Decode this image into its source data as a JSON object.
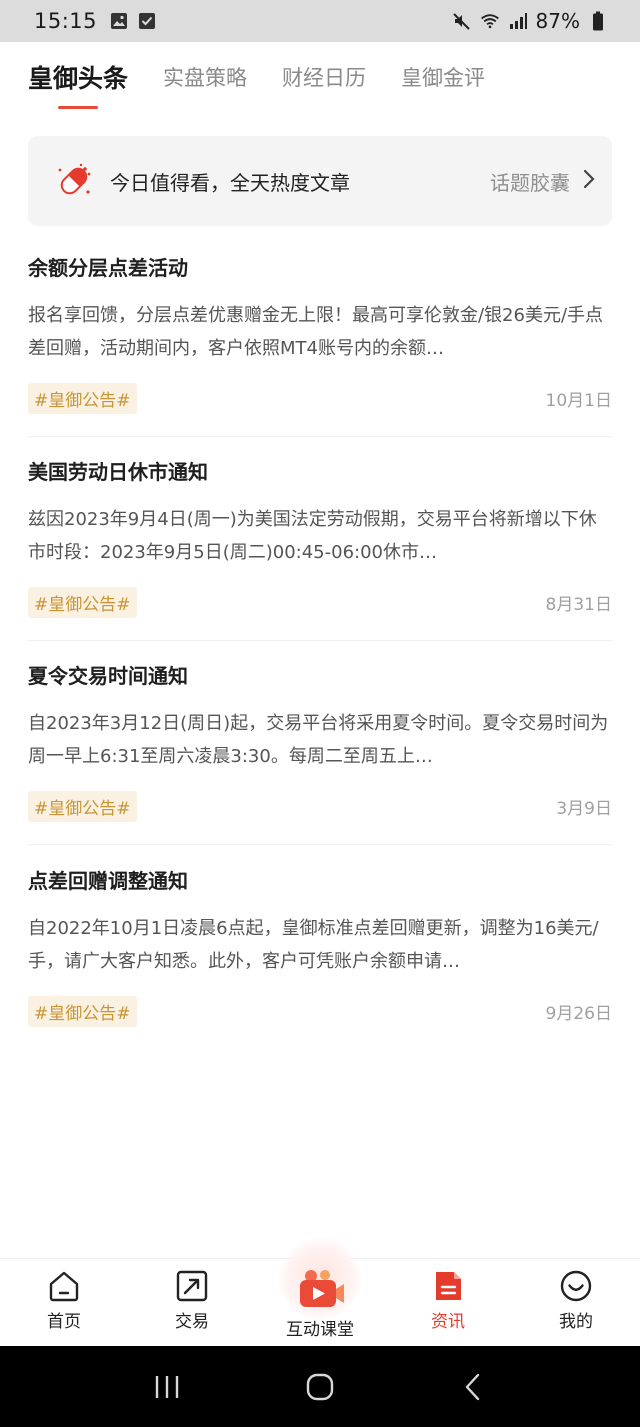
{
  "status_bar": {
    "time": "15:15",
    "battery": "87%",
    "icons": [
      "image-icon",
      "checkbox-icon",
      "mute-icon",
      "wifi-icon",
      "signal-icon",
      "battery-icon"
    ]
  },
  "tabs": [
    {
      "label": "皇御头条",
      "active": true
    },
    {
      "label": "实盘策略",
      "active": false
    },
    {
      "label": "财经日历",
      "active": false
    },
    {
      "label": "皇御金评",
      "active": false
    }
  ],
  "banner": {
    "text": "今日值得看，全天热度文章",
    "link": "话题胶囊"
  },
  "articles": [
    {
      "title": "余额分层点差活动",
      "desc": "报名享回馈，分层点差优惠赠金无上限！最高可享伦敦金/银26美元/手点差回赠，活动期间内，客户依照MT4账号内的余额…",
      "tag": "#皇御公告#",
      "date": "10月1日"
    },
    {
      "title": "美国劳动日休市通知",
      "desc": "兹因2023年9月4日(周一)为美国法定劳动假期，交易平台将新增以下休市时段：2023年9月5日(周二)00:45-06:00休市…",
      "tag": "#皇御公告#",
      "date": "8月31日"
    },
    {
      "title": "夏令交易时间通知",
      "desc": "自2023年3月12日(周日)起，交易平台将采用夏令时间。夏令交易时间为周一早上6:31至周六凌晨3:30。每周二至周五上…",
      "tag": "#皇御公告#",
      "date": "3月9日"
    },
    {
      "title": "点差回赠调整通知",
      "desc": "自2022年10月1日凌晨6点起，皇御标准点差回赠更新，调整为16美元/手，请广大客户知悉。此外，客户可凭账户余额申请…",
      "tag": "#皇御公告#",
      "date": "9月26日"
    }
  ],
  "bottom_nav": [
    {
      "label": "首页",
      "icon": "home-icon",
      "active": false
    },
    {
      "label": "交易",
      "icon": "trade-chart-icon",
      "active": false
    },
    {
      "label": "互动课堂",
      "icon": "video-class-icon",
      "active": false
    },
    {
      "label": "资讯",
      "icon": "news-doc-icon",
      "active": true
    },
    {
      "label": "我的",
      "icon": "profile-smile-icon",
      "active": false
    }
  ],
  "colors": {
    "accent": "#e53b2c",
    "tag_text": "#c99433",
    "tag_bg": "#faf1e2"
  }
}
